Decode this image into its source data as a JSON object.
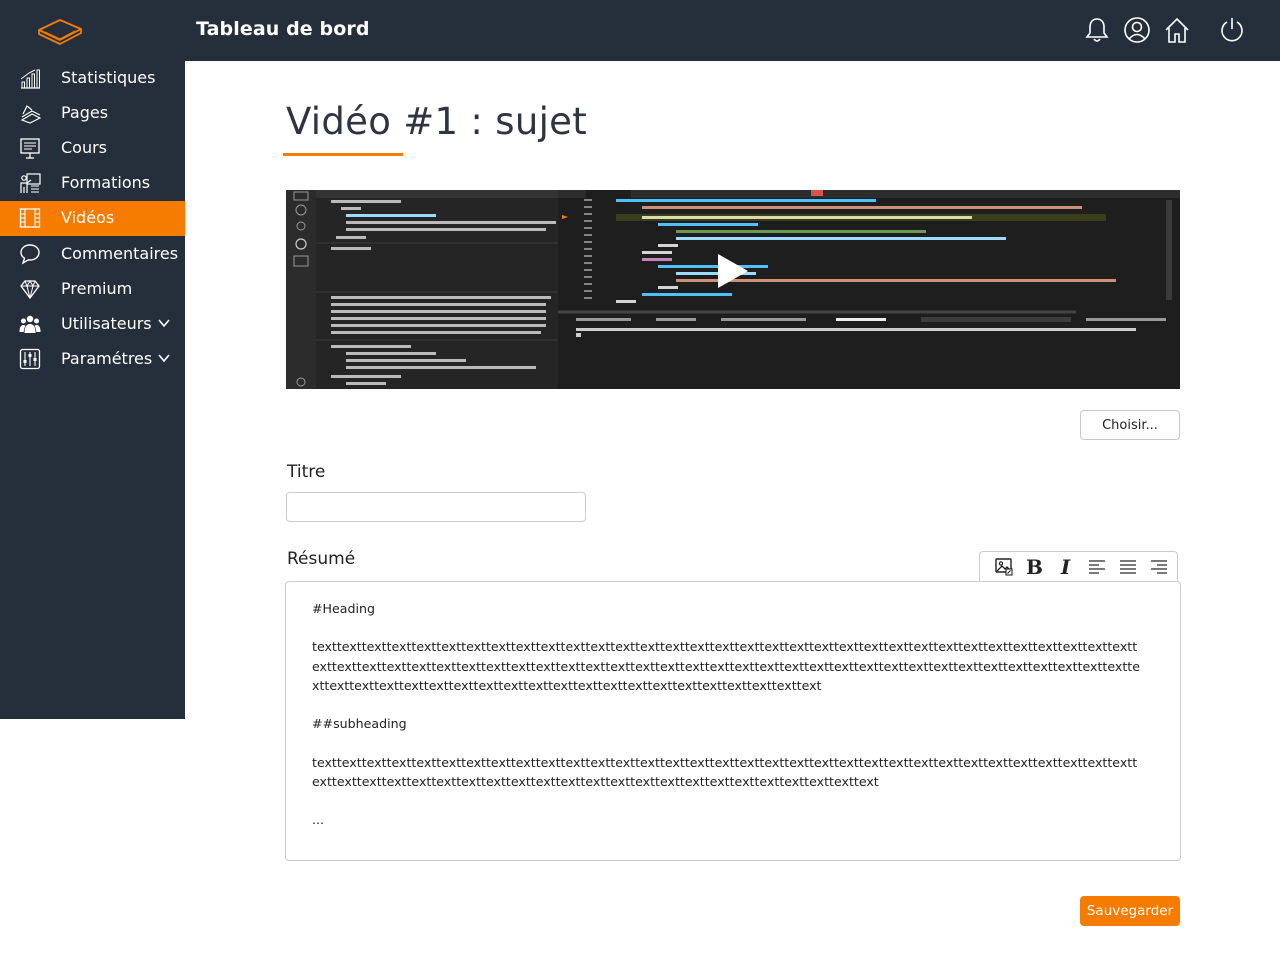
{
  "header": {
    "title": "Tableau de bord",
    "icons": [
      "bell-icon",
      "user-icon",
      "home-icon",
      "power-icon"
    ]
  },
  "sidebar": {
    "items": [
      {
        "label": "Statistiques",
        "icon": "chart-icon"
      },
      {
        "label": "Pages",
        "icon": "pages-icon"
      },
      {
        "label": "Cours",
        "icon": "presentation-icon"
      },
      {
        "label": "Formations",
        "icon": "training-icon"
      },
      {
        "label": "Vidéos",
        "icon": "film-icon",
        "active": true
      },
      {
        "label": "Commentaires",
        "icon": "comment-icon"
      },
      {
        "label": "Premium",
        "icon": "diamond-icon"
      },
      {
        "label": "Utilisateurs",
        "icon": "users-icon",
        "expandable": true
      },
      {
        "label": "Paramétres",
        "icon": "sliders-icon",
        "expandable": true
      }
    ]
  },
  "main": {
    "page_title": "Vidéo #1 : sujet",
    "choose_button": "Choisir...",
    "title_label": "Titre",
    "title_value": "",
    "summary_label": "Résumé",
    "toolbar": [
      "image-icon",
      "bold-icon",
      "italic-icon",
      "align-left-icon",
      "align-justify-icon",
      "align-right-icon"
    ],
    "editor": {
      "heading": "#Heading",
      "para1": "texttexttexttexttexttexttexttexttexttexttexttexttexttexttexttexttexttexttexttexttexttexttexttexttexttexttexttexttexttexttexttexttexttexttexttexttexttexttexttexttexttexttexttexttexttexttexttexttexttexttexttexttexttexttexttexttexttexttexttexttexttexttexttexttexttexttexttexttexttexttexttexttexttexttexttexttexttexttexttexttexttexttexttexttexttexttext",
      "subheading": "##subheading",
      "para2": "texttexttexttexttexttexttexttexttexttexttexttexttexttexttexttexttexttexttexttexttexttexttexttexttexttexttexttexttexttexttexttexttexttexttexttexttexttexttexttexttexttexttexttexttexttexttexttexttexttexttexttexttexttexttexttext",
      "ellipsis": "..."
    },
    "save_button": "Sauvegarder"
  },
  "colors": {
    "sidebar_bg": "#252f3b",
    "accent": "#f57c00"
  }
}
